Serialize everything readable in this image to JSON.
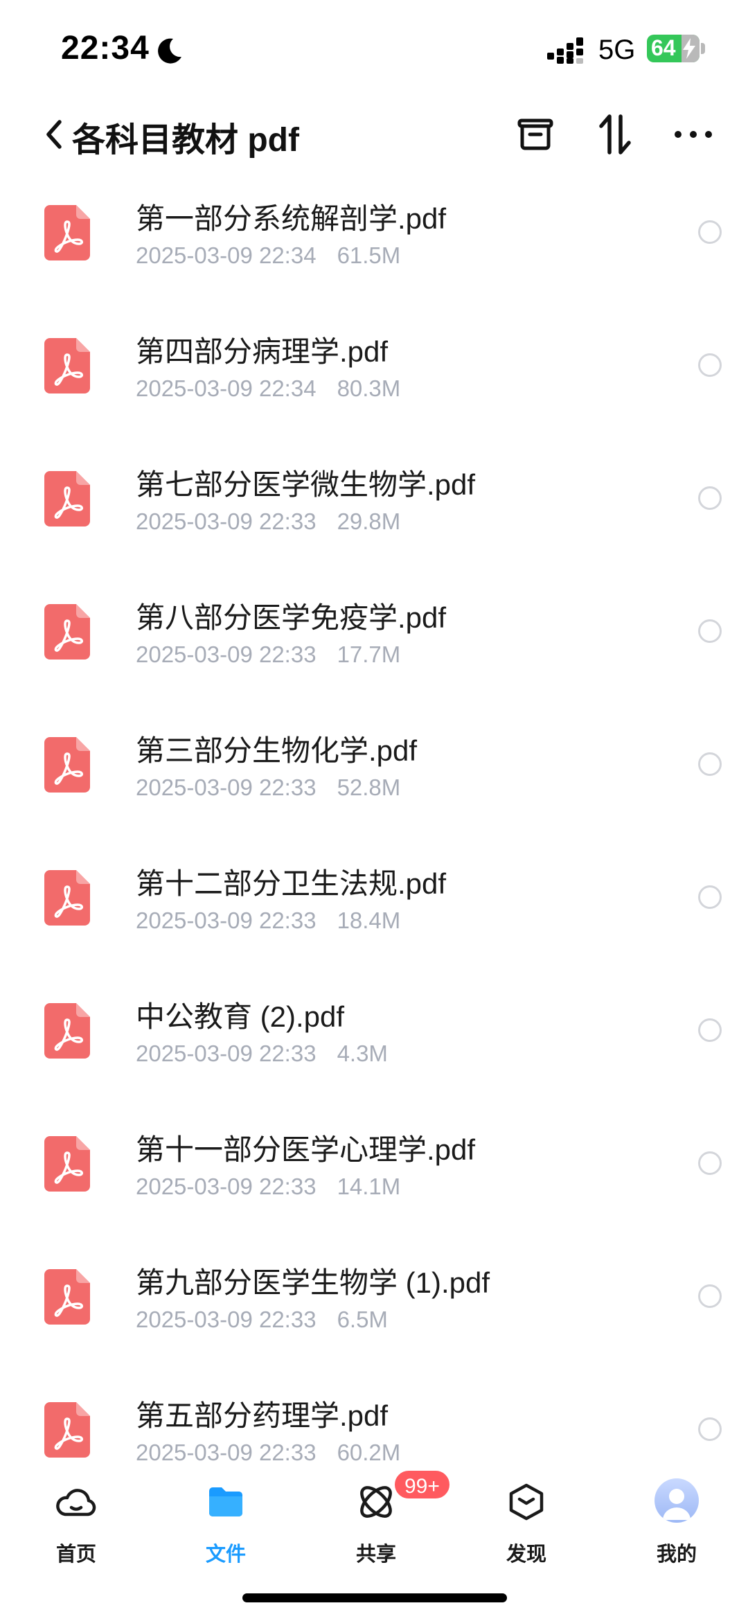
{
  "status_bar": {
    "time": "22:34",
    "network": "5G",
    "battery": "64"
  },
  "header": {
    "title": "各科目教材 pdf"
  },
  "files": [
    {
      "name": "第一部分系统解剖学.pdf",
      "date": "2025-03-09 22:34",
      "size": "61.5M"
    },
    {
      "name": "第四部分病理学.pdf",
      "date": "2025-03-09 22:34",
      "size": "80.3M"
    },
    {
      "name": "第七部分医学微生物学.pdf",
      "date": "2025-03-09 22:33",
      "size": "29.8M"
    },
    {
      "name": "第八部分医学免疫学.pdf",
      "date": "2025-03-09 22:33",
      "size": "17.7M"
    },
    {
      "name": "第三部分生物化学.pdf",
      "date": "2025-03-09 22:33",
      "size": "52.8M"
    },
    {
      "name": "第十二部分卫生法规.pdf",
      "date": "2025-03-09 22:33",
      "size": "18.4M"
    },
    {
      "name": "中公教育 (2).pdf",
      "date": "2025-03-09 22:33",
      "size": "4.3M"
    },
    {
      "name": "第十一部分医学心理学.pdf",
      "date": "2025-03-09 22:33",
      "size": "14.1M"
    },
    {
      "name": "第九部分医学生物学 (1).pdf",
      "date": "2025-03-09 22:33",
      "size": "6.5M"
    },
    {
      "name": "第五部分药理学.pdf",
      "date": "2025-03-09 22:33",
      "size": "60.2M"
    }
  ],
  "tab_bar": {
    "tabs": [
      {
        "label": "首页",
        "icon": "cloud-icon"
      },
      {
        "label": "文件",
        "icon": "folder-icon",
        "active": true
      },
      {
        "label": "共享",
        "icon": "share-orbit-icon",
        "badge": "99+"
      },
      {
        "label": "发现",
        "icon": "discover-box-icon"
      },
      {
        "label": "我的",
        "icon": "avatar"
      }
    ]
  },
  "colors": {
    "accent": "#1a9bff",
    "pdf_icon": "#f26b6b",
    "meta_text": "#a7acb7",
    "badge": "#ff5a5f",
    "battery": "#34c759"
  }
}
